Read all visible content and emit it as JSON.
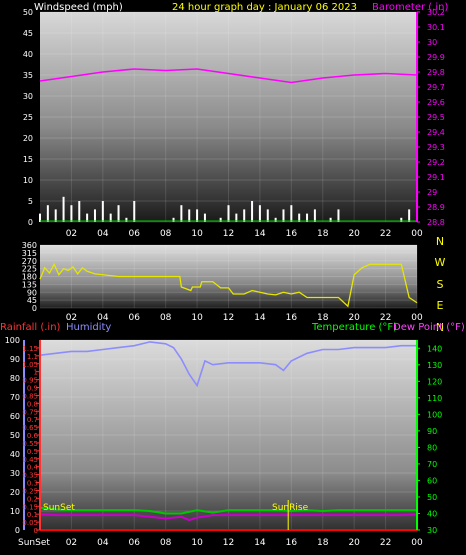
{
  "header": {
    "windspeed_label": "Windspeed (mph)",
    "title": "24 hour graph day : January 06 2023",
    "barometer_label": "Barometer (.in)"
  },
  "labels": {
    "rainfall": "Rainfall (.in)",
    "humidity": "Humidity",
    "temperature": "Temperature (°F)",
    "dewpoint": "Dew Point (°F)",
    "sunset_axis": "SunSet",
    "sunset_marker": "SunSet",
    "sunrise_marker": "SunRise"
  },
  "colors": {
    "barometer": "#ff00ff",
    "windspeed": "#ffffff",
    "direction": "#e6e600",
    "humidity": "#8c8cff",
    "temperature": "#00c800",
    "dewpoint": "#c800c8",
    "rain": "#ff0000",
    "header_wind": "#ffffff",
    "header_title": "#ffff00",
    "header_baro": "#ff00ff",
    "axis_text": "#ffffff",
    "temp_axis": "#00ff00",
    "rain_axis": "#ff3333",
    "humidity_axis": "#8c8cff",
    "dew_label": "#ff44ff",
    "compass": "#ffff00"
  },
  "chart_data": [
    {
      "type": "line",
      "name": "wind-baro",
      "x_ticks": [
        "02",
        "04",
        "06",
        "08",
        "10",
        "12",
        "14",
        "16",
        "18",
        "20",
        "22",
        "00"
      ],
      "y_left": {
        "ylim": [
          0,
          50
        ],
        "ticks": [
          0,
          5,
          10,
          15,
          20,
          25,
          30,
          35,
          40,
          45,
          50
        ]
      },
      "y_right": {
        "ylim": [
          28.8,
          30.2
        ],
        "ticks": [
          28.8,
          28.9,
          29,
          29.1,
          29.2,
          29.3,
          29.4,
          29.5,
          29.6,
          29.7,
          29.8,
          29.9,
          30,
          30.1,
          30.2
        ]
      },
      "series": [
        {
          "name": "Barometer",
          "axis": "right",
          "x": [
            0,
            2,
            4,
            6,
            8,
            10,
            12,
            14,
            16,
            18,
            20,
            22,
            24
          ],
          "values": [
            29.74,
            29.77,
            29.8,
            29.82,
            29.81,
            29.82,
            29.79,
            29.76,
            29.73,
            29.76,
            29.78,
            29.79,
            29.78
          ]
        },
        {
          "name": "Windspeed",
          "axis": "left",
          "x": [
            0,
            0.5,
            1,
            1.5,
            2,
            2.5,
            3,
            3.5,
            4,
            4.5,
            5,
            5.5,
            6,
            6.5,
            7,
            7.5,
            8,
            8.5,
            9,
            9.5,
            10,
            10.5,
            11,
            11.5,
            12,
            12.5,
            13,
            13.5,
            14,
            14.5,
            15,
            15.5,
            16,
            16.5,
            17,
            17.5,
            18,
            18.5,
            19,
            19.5,
            20,
            20.5,
            21,
            21.5,
            22,
            22.5,
            23,
            23.5,
            24
          ],
          "values": [
            2,
            4,
            3,
            6,
            4,
            5,
            2,
            3,
            5,
            2,
            4,
            1,
            5,
            0,
            0,
            0,
            0,
            1,
            4,
            3,
            3,
            2,
            0,
            1,
            4,
            2,
            3,
            5,
            4,
            3,
            1,
            3,
            4,
            2,
            2,
            3,
            0,
            1,
            3,
            0,
            0,
            0,
            0,
            0,
            0,
            0,
            1,
            3,
            2
          ]
        }
      ]
    },
    {
      "type": "line",
      "name": "wind-direction",
      "x_ticks": [
        "02",
        "04",
        "06",
        "08",
        "10",
        "12",
        "14",
        "16",
        "18",
        "20",
        "22",
        "00"
      ],
      "y_left": {
        "ylim": [
          0,
          360
        ],
        "ticks": [
          0,
          45,
          90,
          135,
          180,
          225,
          270,
          315,
          360
        ]
      },
      "y_right_labels": [
        "N",
        "W",
        "S",
        "E",
        "N"
      ],
      "series": [
        {
          "name": "Wind Direction",
          "x": [
            0,
            0.3,
            0.6,
            0.9,
            1.2,
            1.5,
            1.8,
            2.1,
            2.4,
            2.7,
            3,
            3.5,
            4,
            5,
            6,
            7,
            8,
            8.9,
            9,
            9.6,
            9.7,
            10.2,
            10.3,
            11,
            11.5,
            12,
            12.3,
            13,
            13.5,
            14,
            14.5,
            15,
            15.5,
            16,
            16.5,
            17,
            18,
            19,
            19.6,
            20,
            20.5,
            21,
            22,
            23,
            23.5,
            24
          ],
          "values": [
            165,
            230,
            200,
            250,
            190,
            225,
            215,
            235,
            195,
            230,
            210,
            195,
            190,
            180,
            180,
            180,
            180,
            180,
            120,
            100,
            120,
            120,
            150,
            150,
            115,
            115,
            80,
            80,
            100,
            90,
            80,
            75,
            90,
            80,
            90,
            60,
            60,
            60,
            10,
            190,
            230,
            250,
            250,
            250,
            60,
            30
          ]
        }
      ]
    },
    {
      "type": "line",
      "name": "rain-humidity-temp",
      "x_ticks": [
        "02",
        "04",
        "06",
        "08",
        "10",
        "12",
        "14",
        "16",
        "18",
        "20",
        "22",
        "00"
      ],
      "y_left": {
        "ylim": [
          0,
          100
        ],
        "ticks": [
          0,
          10,
          20,
          30,
          40,
          50,
          60,
          70,
          80,
          90,
          100
        ]
      },
      "y_rain": {
        "ylim": [
          0,
          1.2
        ],
        "ticks": [
          0,
          0.05,
          0.1,
          0.15,
          0.2,
          0.25,
          0.3,
          0.35,
          0.4,
          0.45,
          0.5,
          0.55,
          0.6,
          0.65,
          0.7,
          0.75,
          0.8,
          0.85,
          0.9,
          0.95,
          1,
          1.05,
          1.1,
          1.15
        ]
      },
      "y_right": {
        "ylim": [
          30,
          145
        ],
        "ticks": [
          30,
          40,
          50,
          60,
          70,
          80,
          90,
          100,
          110,
          120,
          130,
          140
        ]
      },
      "series": [
        {
          "name": "Humidity",
          "axis": "left",
          "x": [
            0,
            1,
            2,
            3,
            4,
            5,
            6,
            7,
            8,
            8.5,
            9,
            9.5,
            10,
            10.5,
            11,
            12,
            13,
            14,
            15,
            15.5,
            16,
            17,
            18,
            19,
            20,
            21,
            22,
            23,
            24
          ],
          "values": [
            92,
            93,
            94,
            94,
            95,
            96,
            97,
            99,
            98,
            96,
            90,
            82,
            76,
            89,
            87,
            88,
            88,
            88,
            87,
            84,
            89,
            93,
            95,
            95,
            96,
            96,
            96,
            97,
            97
          ]
        },
        {
          "name": "Temperature",
          "axis": "right",
          "x": [
            0,
            1,
            2,
            3,
            4,
            5,
            6,
            7,
            8,
            9,
            10,
            11,
            12,
            13,
            14,
            15,
            16,
            17,
            18,
            19,
            20,
            21,
            22,
            23,
            24
          ],
          "values": [
            43.5,
            42.5,
            42,
            42,
            42,
            42,
            42,
            41.5,
            40,
            40,
            42,
            40.5,
            42,
            42,
            42,
            42,
            41.5,
            42,
            41.5,
            42,
            42,
            42,
            42,
            42,
            42
          ]
        },
        {
          "name": "Dew Point",
          "axis": "right",
          "x": [
            0,
            1,
            2,
            3,
            4,
            5,
            6,
            7,
            8,
            9,
            9.5,
            10,
            11,
            12,
            13,
            14,
            15,
            16,
            17,
            18,
            19,
            20,
            21,
            22,
            23,
            24
          ],
          "values": [
            39.5,
            39,
            39,
            39,
            39,
            39,
            39,
            38,
            37,
            38,
            36,
            37.5,
            39,
            39,
            39,
            39,
            39,
            39,
            39,
            39,
            39,
            39,
            39,
            39,
            39,
            39.5
          ]
        },
        {
          "name": "Rainfall",
          "axis": "rain",
          "x": [
            0,
            24
          ],
          "values": [
            0,
            0
          ]
        }
      ],
      "markers": [
        {
          "label": "SunSet",
          "x": 0
        },
        {
          "label": "SunRise",
          "x": 15.8
        }
      ]
    }
  ]
}
